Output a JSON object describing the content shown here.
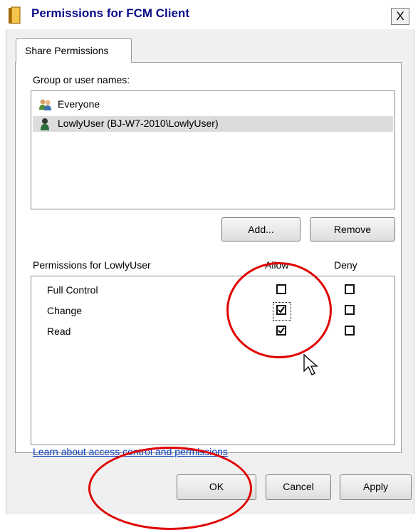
{
  "window": {
    "title": "Permissions for FCM Client",
    "close_label": "X"
  },
  "tabs": [
    {
      "label": "Share Permissions"
    }
  ],
  "groups": {
    "label": "Group or user names:",
    "items": [
      {
        "name": "Everyone",
        "icon": "users-group-icon",
        "selected": false
      },
      {
        "name": "LowlyUser (BJ-W7-2010\\LowlyUser)",
        "icon": "user-icon",
        "selected": true
      }
    ],
    "add_label": "Add...",
    "remove_label": "Remove"
  },
  "permissions": {
    "label": "Permissions for LowlyUser",
    "allow_header": "Allow",
    "deny_header": "Deny",
    "rows": [
      {
        "name": "Full Control",
        "allow": false,
        "deny": false
      },
      {
        "name": "Change",
        "allow": true,
        "deny": false,
        "focused": true
      },
      {
        "name": "Read",
        "allow": true,
        "deny": false
      }
    ]
  },
  "link": {
    "text": "Learn about access control and permissions"
  },
  "buttons": {
    "ok": "OK",
    "cancel": "Cancel",
    "apply": "Apply"
  },
  "annotations": {
    "color": "#e00000"
  }
}
